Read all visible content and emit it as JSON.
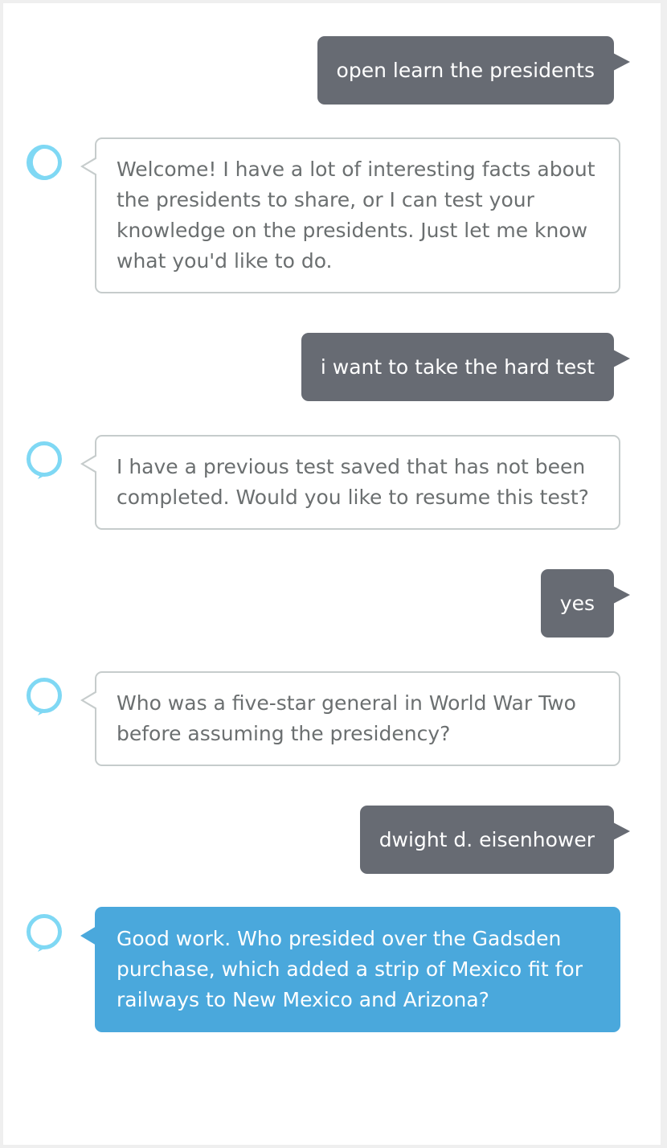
{
  "conversation": {
    "messages": [
      {
        "sender": "user",
        "text": "open learn the presidents"
      },
      {
        "sender": "alexa",
        "text": "Welcome! I have a lot of interesting facts about the presidents to share, or I can test your knowledge on the presidents. Just let me know what you'd like to do."
      },
      {
        "sender": "user",
        "text": "i want to take the hard test"
      },
      {
        "sender": "alexa",
        "text": "I have a previous test saved that has not been completed. Would you like to resume this test?"
      },
      {
        "sender": "user",
        "text": "yes"
      },
      {
        "sender": "alexa",
        "text": "Who was a five-star general in World War Two before assuming the presidency?"
      },
      {
        "sender": "user",
        "text": "dwight d. eisenhower"
      },
      {
        "sender": "alexa",
        "text": "Good work. Who presided over the Gadsden purchase, which added a strip of Mexico fit for railways to New Mexico and Arizona?",
        "highlighted": true
      }
    ]
  },
  "icons": {
    "assistant_avatar": "alexa-ring-icon"
  },
  "colors": {
    "user_bubble": "#676b73",
    "alexa_bubble_border": "#c6cccc",
    "alexa_text": "#6b6f70",
    "active_bubble": "#4aa8dc",
    "alexa_ring": "#7fd8f4"
  }
}
